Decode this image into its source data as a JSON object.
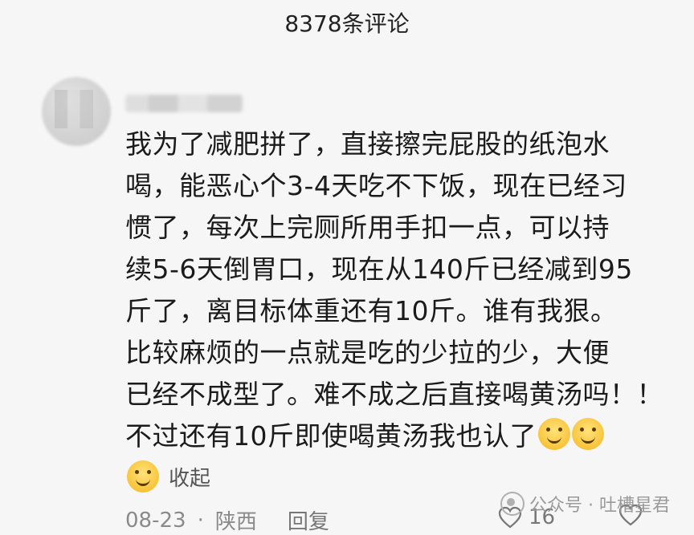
{
  "header": {
    "title": "8378条评论"
  },
  "comment": {
    "lines": [
      "我为了减肥拼了，直接擦完屁股的纸泡水",
      "喝，能恶心个3-4天吃不下饭，现在已经习",
      "惯了，每次上完厕所用手扣一点，可以持",
      "续5-6天倒胃口，现在从140斤已经减到95",
      "斤了，离目标体重还有10斤。谁有我狠。",
      "比较麻烦的一点就是吃的少拉的少，大便",
      "已经不成型了。难不成之后直接喝黄汤吗！！",
      "不过还有10斤即使喝黄汤我也认了"
    ],
    "emojis": [
      "smile-emoji",
      "smile-emoji"
    ],
    "collapse_label": "收起",
    "date": "08-23",
    "separator": "·",
    "location": "陕西",
    "reply_label": "回复",
    "like_count": "16"
  },
  "watermark": {
    "text": "公众号 · 吐槽星君"
  },
  "icons": {
    "emoji": "smile-emoji-icon",
    "heart": "heart-outline-icon",
    "watermark": "wechat-logo-icon"
  },
  "colors": {
    "background": "#f6f6f6",
    "text": "#1b1b1b",
    "meta": "#8a8a8a",
    "emoji": "#f8c43a"
  }
}
